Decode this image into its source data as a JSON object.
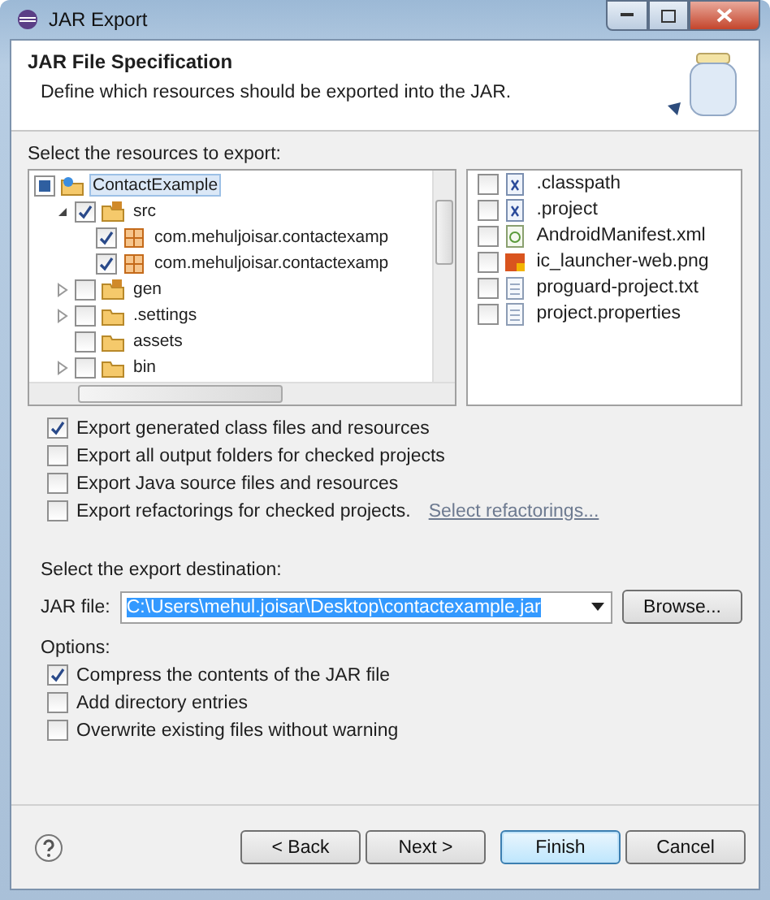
{
  "window": {
    "title": "JAR Export"
  },
  "header": {
    "title": "JAR File Specification",
    "description": "Define which resources should be exported into the JAR."
  },
  "resources": {
    "label": "Select the resources to export:",
    "tree": [
      {
        "label": "ContactExample",
        "kind": "project",
        "checked": false,
        "partial": true,
        "selected": true,
        "children": [
          {
            "label": "src",
            "kind": "source-folder",
            "checked": true,
            "selected": false,
            "expanded": true,
            "children": [
              {
                "label": "com.mehuljoisar.contactexamp",
                "kind": "package",
                "checked": true,
                "selected": false
              },
              {
                "label": "com.mehuljoisar.contactexamp",
                "kind": "package",
                "checked": true,
                "selected": false
              }
            ]
          },
          {
            "label": "gen",
            "kind": "source-folder",
            "checked": false,
            "selected": false,
            "expanded": false
          },
          {
            "label": ".settings",
            "kind": "folder",
            "checked": false,
            "selected": false,
            "expanded": false
          },
          {
            "label": "assets",
            "kind": "folder",
            "checked": false,
            "selected": false
          },
          {
            "label": "bin",
            "kind": "folder",
            "checked": false,
            "selected": false,
            "expanded": false
          }
        ]
      }
    ],
    "files": [
      {
        "label": ".classpath",
        "kind": "x",
        "checked": false
      },
      {
        "label": ".project",
        "kind": "x",
        "checked": false
      },
      {
        "label": "AndroidManifest.xml",
        "kind": "xml",
        "checked": false
      },
      {
        "label": "ic_launcher-web.png",
        "kind": "image",
        "checked": false
      },
      {
        "label": "proguard-project.txt",
        "kind": "text",
        "checked": false
      },
      {
        "label": "project.properties",
        "kind": "text",
        "checked": false
      }
    ]
  },
  "export_options": [
    {
      "label": "Export generated class files and resources",
      "checked": true
    },
    {
      "label": "Export all output folders for checked projects",
      "checked": false
    },
    {
      "label": "Export Java source files and resources",
      "checked": false
    },
    {
      "label": "Export refactorings for checked projects.",
      "checked": false,
      "link": "Select refactorings..."
    }
  ],
  "destination": {
    "label": "Select the export destination:",
    "field_label": "JAR file:",
    "value": "C:\\Users\\mehul.joisar\\Desktop\\contactexample.jar",
    "browse": "Browse..."
  },
  "options": {
    "label": "Options:",
    "items": [
      {
        "label": "Compress the contents of the JAR file",
        "checked": true
      },
      {
        "label": "Add directory entries",
        "checked": false
      },
      {
        "label": "Overwrite existing files without warning",
        "checked": false
      }
    ]
  },
  "buttons": [
    {
      "label": "< Back",
      "default": false
    },
    {
      "label": "Next >",
      "default": false
    },
    {
      "label": "Finish",
      "default": true
    },
    {
      "label": "Cancel",
      "default": false
    }
  ]
}
